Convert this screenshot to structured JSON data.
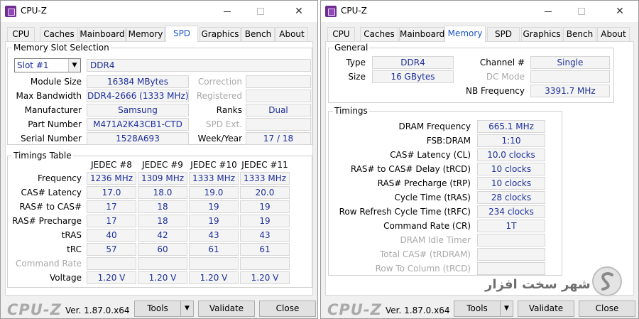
{
  "windows": [
    {
      "title": "CPU-Z",
      "tabs": [
        "CPU",
        "Caches",
        "Mainboard",
        "Memory",
        "SPD",
        "Graphics",
        "Bench",
        "About"
      ],
      "active_tab": "SPD",
      "memory_slot": {
        "group_title": "Memory Slot Selection",
        "slot": "Slot #1",
        "type": "DDR4",
        "module_size_label": "Module Size",
        "module_size": "16384 MBytes",
        "max_bandwidth_label": "Max Bandwidth",
        "max_bandwidth": "DDR4-2666 (1333 MHz)",
        "manufacturer_label": "Manufacturer",
        "manufacturer": "Samsung",
        "part_number_label": "Part Number",
        "part_number": "M471A2K43CB1-CTD",
        "serial_number_label": "Serial Number",
        "serial_number": "1528A693",
        "correction_label": "Correction",
        "correction": "",
        "registered_label": "Registered",
        "registered": "",
        "ranks_label": "Ranks",
        "ranks": "Dual",
        "spd_ext_label": "SPD Ext.",
        "spd_ext": "",
        "week_year_label": "Week/Year",
        "week_year": "17 / 18"
      },
      "timings_table": {
        "group_title": "Timings Table",
        "columns": [
          "JEDEC #8",
          "JEDEC #9",
          "JEDEC #10",
          "JEDEC #11"
        ],
        "rows": [
          {
            "label": "Frequency",
            "values": [
              "1236 MHz",
              "1309 MHz",
              "1333 MHz",
              "1333 MHz"
            ]
          },
          {
            "label": "CAS# Latency",
            "values": [
              "17.0",
              "18.0",
              "19.0",
              "20.0"
            ]
          },
          {
            "label": "RAS# to CAS#",
            "values": [
              "17",
              "18",
              "19",
              "19"
            ]
          },
          {
            "label": "RAS# Precharge",
            "values": [
              "17",
              "18",
              "19",
              "19"
            ]
          },
          {
            "label": "tRAS",
            "values": [
              "40",
              "42",
              "43",
              "43"
            ]
          },
          {
            "label": "tRC",
            "values": [
              "57",
              "60",
              "61",
              "61"
            ]
          },
          {
            "label": "Command Rate",
            "values": [
              "",
              "",
              "",
              ""
            ],
            "dim": true
          },
          {
            "label": "Voltage",
            "values": [
              "1.20 V",
              "1.20 V",
              "1.20 V",
              "1.20 V"
            ]
          }
        ]
      },
      "footer": {
        "brand": "CPU-Z",
        "version": "Ver. 1.87.0.x64",
        "tools": "Tools",
        "validate": "Validate",
        "close": "Close"
      }
    },
    {
      "title": "CPU-Z",
      "tabs": [
        "CPU",
        "Caches",
        "Mainboard",
        "Memory",
        "SPD",
        "Graphics",
        "Bench",
        "About"
      ],
      "active_tab": "Memory",
      "general": {
        "group_title": "General",
        "type_label": "Type",
        "type": "DDR4",
        "size_label": "Size",
        "size": "16 GBytes",
        "channel_label": "Channel #",
        "channel": "Single",
        "dc_mode_label": "DC Mode",
        "dc_mode": "",
        "nb_frequency_label": "NB Frequency",
        "nb_frequency": "3391.7 MHz"
      },
      "timings": {
        "group_title": "Timings",
        "rows": [
          {
            "label": "DRAM Frequency",
            "value": "665.1 MHz"
          },
          {
            "label": "FSB:DRAM",
            "value": "1:10"
          },
          {
            "label": "CAS# Latency (CL)",
            "value": "10.0 clocks"
          },
          {
            "label": "RAS# to CAS# Delay (tRCD)",
            "value": "10 clocks"
          },
          {
            "label": "RAS# Precharge (tRP)",
            "value": "10 clocks"
          },
          {
            "label": "Cycle Time (tRAS)",
            "value": "28 clocks"
          },
          {
            "label": "Row Refresh Cycle Time (tRFC)",
            "value": "234 clocks"
          },
          {
            "label": "Command Rate (CR)",
            "value": "1T"
          },
          {
            "label": "DRAM Idle Timer",
            "value": "",
            "dim": true
          },
          {
            "label": "Total CAS# (tRDRAM)",
            "value": "",
            "dim": true
          },
          {
            "label": "Row To Column (tRCD)",
            "value": "",
            "dim": true
          }
        ]
      },
      "footer": {
        "brand": "CPU-Z",
        "version": "Ver. 1.87.0.x64",
        "tools": "Tools",
        "validate": "Validate",
        "close": "Close"
      }
    }
  ],
  "watermark": {
    "text": "شهر سخت افزار"
  }
}
